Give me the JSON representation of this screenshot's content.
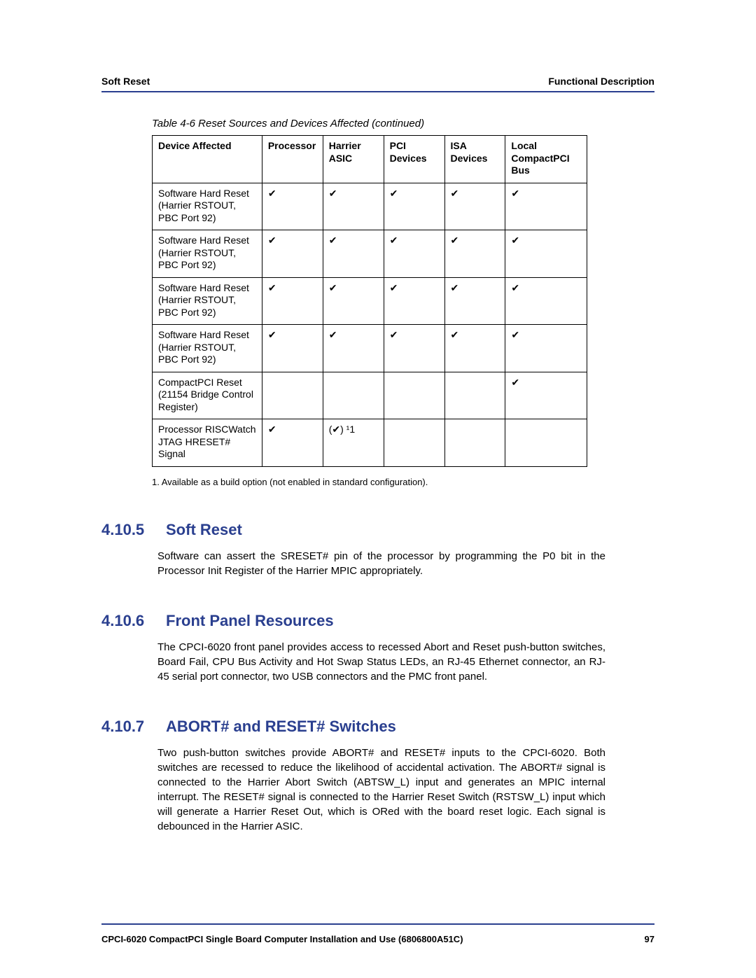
{
  "header": {
    "left": "Soft Reset",
    "right": "Functional Description"
  },
  "table": {
    "caption": "Table 4-6 Reset Sources and Devices Affected (continued)",
    "headers": [
      "Device Affected",
      "Processor",
      "Harrier ASIC",
      "PCI Devices",
      "ISA Devices",
      "Local CompactPCI Bus"
    ],
    "rows": [
      {
        "label": "Software Hard Reset (Harrier RSTOUT, PBC Port 92)",
        "cells": [
          "✔",
          "✔",
          "✔",
          "✔",
          "✔"
        ]
      },
      {
        "label": "Software Hard Reset (Harrier RSTOUT, PBC Port 92)",
        "cells": [
          "✔",
          "✔",
          "✔",
          "✔",
          "✔"
        ]
      },
      {
        "label": "Software Hard Reset (Harrier RSTOUT, PBC Port 92)",
        "cells": [
          "✔",
          "✔",
          "✔",
          "✔",
          "✔"
        ]
      },
      {
        "label": "Software Hard Reset (Harrier RSTOUT, PBC Port 92)",
        "cells": [
          "✔",
          "✔",
          "✔",
          "✔",
          "✔"
        ]
      },
      {
        "label": "CompactPCI Reset (21154 Bridge Control Register)",
        "cells": [
          "",
          "",
          "",
          "",
          "✔"
        ]
      },
      {
        "label": "Processor RISCWatch JTAG HRESET# Signal",
        "cells": [
          "✔",
          "(✔) ¹1",
          "",
          "",
          ""
        ]
      }
    ]
  },
  "footnote": "1. Available as a build option (not enabled in standard configuration).",
  "sections": [
    {
      "num": "4.10.5",
      "title": "Soft Reset",
      "body": "Software can assert the SRESET# pin of the processor by programming the P0 bit in the Processor Init Register of the Harrier MPIC appropriately."
    },
    {
      "num": "4.10.6",
      "title": "Front Panel Resources",
      "body": "The CPCI-6020 front panel provides access to recessed Abort and Reset push-button switches, Board Fail, CPU Bus Activity and Hot Swap Status LEDs, an RJ-45 Ethernet connector, an RJ-45 serial port connector, two USB connectors and the PMC front panel."
    },
    {
      "num": "4.10.7",
      "title": "ABORT# and RESET# Switches",
      "body": "Two push-button switches provide ABORT# and RESET# inputs to the CPCI-6020. Both switches are recessed to reduce the likelihood of accidental activation. The ABORT# signal is connected to the Harrier Abort Switch (ABTSW_L) input and generates an MPIC internal interrupt. The RESET# signal is connected to the Harrier Reset Switch (RSTSW_L) input which will generate a Harrier Reset Out, which is ORed with the board reset logic. Each signal is debounced in the Harrier ASIC."
    }
  ],
  "footer": {
    "left": "CPCI-6020 CompactPCI Single Board Computer Installation and Use (6806800A51C)",
    "right": "97"
  }
}
